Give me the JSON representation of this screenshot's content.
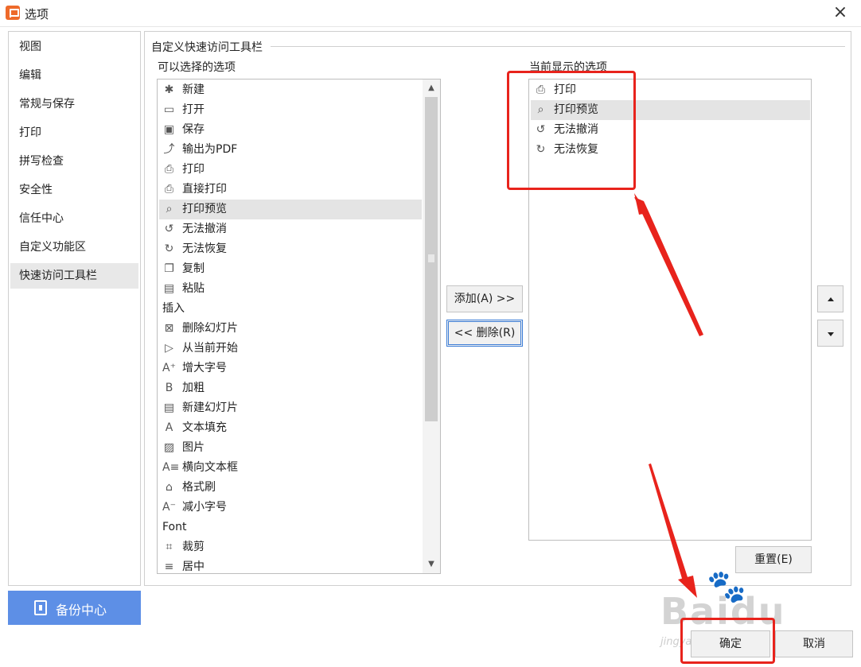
{
  "window": {
    "title": "选项",
    "close_symbol": "×"
  },
  "sidebar": {
    "items": [
      {
        "label": "视图"
      },
      {
        "label": "编辑"
      },
      {
        "label": "常规与保存"
      },
      {
        "label": "打印"
      },
      {
        "label": "拼写检查"
      },
      {
        "label": "安全性"
      },
      {
        "label": "信任中心"
      },
      {
        "label": "自定义功能区"
      },
      {
        "label": "快速访问工具栏",
        "active": true
      }
    ],
    "backup_label": "备份中心"
  },
  "panel": {
    "group_title": "自定义快速访问工具栏",
    "available_label": "可以选择的选项",
    "current_label": "当前显示的选项"
  },
  "available_items": [
    {
      "label": "新建",
      "icon": "new-document-icon"
    },
    {
      "label": "打开",
      "icon": "open-folder-icon"
    },
    {
      "label": "保存",
      "icon": "save-icon"
    },
    {
      "label": "输出为PDF",
      "icon": "export-pdf-icon"
    },
    {
      "label": "打印",
      "icon": "print-icon"
    },
    {
      "label": "直接打印",
      "icon": "direct-print-icon"
    },
    {
      "label": "打印预览",
      "icon": "print-preview-icon",
      "selected": true
    },
    {
      "label": "无法撤消",
      "icon": "undo-icon"
    },
    {
      "label": "无法恢复",
      "icon": "redo-icon"
    },
    {
      "label": "复制",
      "icon": "copy-icon"
    },
    {
      "label": "粘贴",
      "icon": "paste-icon"
    },
    {
      "label": "插入",
      "category": true
    },
    {
      "label": "删除幻灯片",
      "icon": "delete-slide-icon"
    },
    {
      "label": "从当前开始",
      "icon": "play-from-current-icon"
    },
    {
      "label": "增大字号",
      "icon": "increase-font-icon"
    },
    {
      "label": "加粗",
      "icon": "bold-icon"
    },
    {
      "label": "新建幻灯片",
      "icon": "new-slide-icon"
    },
    {
      "label": "文本填充",
      "icon": "text-fill-icon"
    },
    {
      "label": "图片",
      "icon": "picture-icon"
    },
    {
      "label": "横向文本框",
      "icon": "text-box-icon"
    },
    {
      "label": "格式刷",
      "icon": "format-painter-icon"
    },
    {
      "label": "减小字号",
      "icon": "decrease-font-icon"
    },
    {
      "label": "Font",
      "category": true
    },
    {
      "label": "裁剪",
      "icon": "crop-icon"
    },
    {
      "label": "居中",
      "icon": "align-center-icon"
    }
  ],
  "current_items": [
    {
      "label": "打印",
      "icon": "print-icon"
    },
    {
      "label": "打印预览",
      "icon": "print-preview-icon",
      "selected": true
    },
    {
      "label": "无法撤消",
      "icon": "undo-icon"
    },
    {
      "label": "无法恢复",
      "icon": "redo-icon"
    }
  ],
  "buttons": {
    "add": "添加(A) >>",
    "remove": "<< 删除(R)",
    "reset": "重置(E)",
    "ok": "确定",
    "cancel": "取消"
  },
  "watermark": {
    "brand": "Baidu",
    "sub": "jingyan.baidu.com",
    "paw": "🐾"
  },
  "colors": {
    "accent": "#5d8fe6",
    "annotation": "#e8231c",
    "selection": "#e4e4e4"
  }
}
